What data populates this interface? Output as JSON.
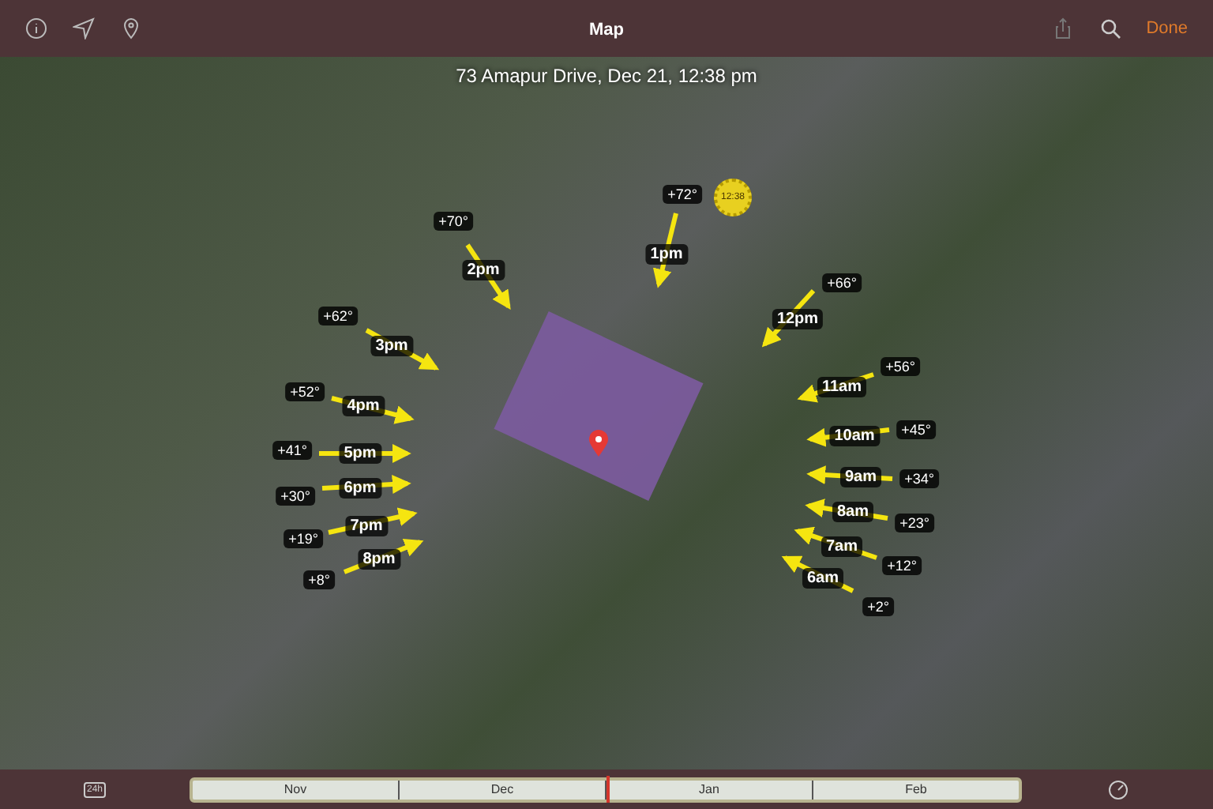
{
  "toolbar": {
    "title": "Map",
    "done_label": "Done"
  },
  "map": {
    "caption": "73 Amapur Drive, Dec 21, 12:38 pm",
    "sun_marker": "12:38",
    "hours": [
      {
        "label": "1pm",
        "elevation": "+72°"
      },
      {
        "label": "2pm",
        "elevation": "+70°"
      },
      {
        "label": "3pm",
        "elevation": "+62°"
      },
      {
        "label": "4pm",
        "elevation": "+52°"
      },
      {
        "label": "5pm",
        "elevation": "+41°"
      },
      {
        "label": "6pm",
        "elevation": "+30°"
      },
      {
        "label": "7pm",
        "elevation": "+19°"
      },
      {
        "label": "8pm",
        "elevation": "+8°"
      },
      {
        "label": "12pm",
        "elevation": "+66°"
      },
      {
        "label": "11am",
        "elevation": "+56°"
      },
      {
        "label": "10am",
        "elevation": "+45°"
      },
      {
        "label": "9am",
        "elevation": "+34°"
      },
      {
        "label": "8am",
        "elevation": "+23°"
      },
      {
        "label": "7am",
        "elevation": "+12°"
      },
      {
        "label": "6am",
        "elevation": "+2°"
      }
    ]
  },
  "timeline": {
    "mode_label": "24h",
    "months": [
      "Nov",
      "Dec",
      "Jan",
      "Feb"
    ],
    "level": 0.5
  }
}
